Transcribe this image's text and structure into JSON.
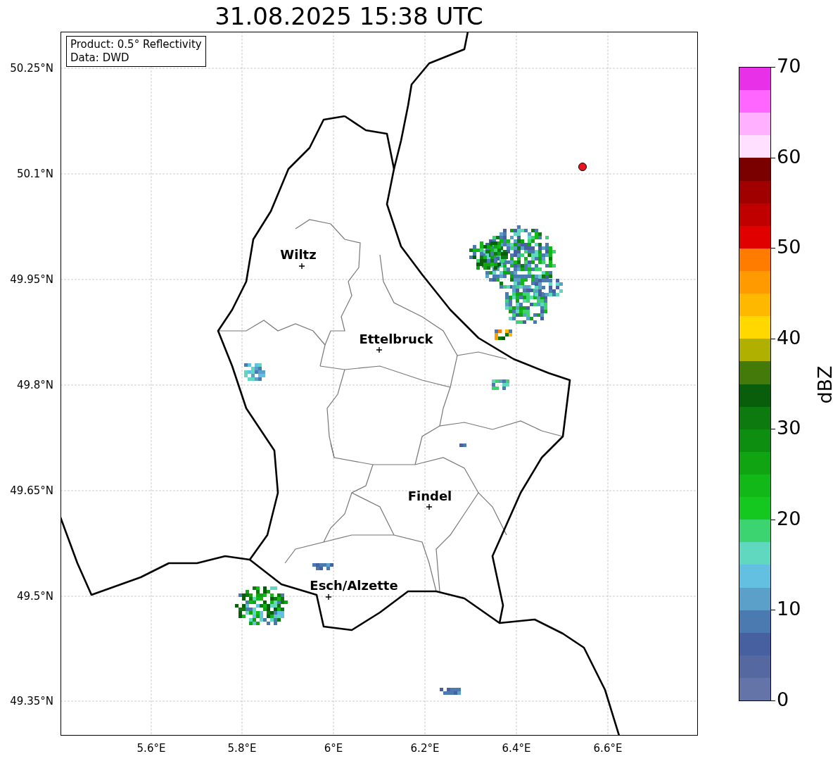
{
  "title": "31.08.2025 15:38 UTC",
  "info_lines": [
    "Product: 0.5° Reflectivity",
    "Data: DWD"
  ],
  "cities": [
    {
      "name": "Wiltz"
    },
    {
      "name": "Ettelbruck"
    },
    {
      "name": "Findel"
    },
    {
      "name": "Esch/Alzette"
    }
  ],
  "lat_ticks": [
    "50.25°N",
    "50.1°N",
    "49.95°N",
    "49.8°N",
    "49.65°N",
    "49.5°N",
    "49.35°N"
  ],
  "lon_ticks": [
    "5.6°E",
    "5.8°E",
    "6°E",
    "6.2°E",
    "6.4°E",
    "6.6°E"
  ],
  "colorbar": {
    "label": "dBZ",
    "ticks": [
      "70",
      "60",
      "50",
      "40",
      "30",
      "20",
      "10",
      "0"
    ],
    "bins": [
      {
        "color": "#e830e8"
      },
      {
        "color": "#ff66ff"
      },
      {
        "color": "#ffb0ff"
      },
      {
        "color": "#ffe0ff"
      },
      {
        "color": "#7a0000"
      },
      {
        "color": "#a00000"
      },
      {
        "color": "#c00000"
      },
      {
        "color": "#e00000"
      },
      {
        "color": "#ff7c00"
      },
      {
        "color": "#ff9a00"
      },
      {
        "color": "#ffb800"
      },
      {
        "color": "#ffd800"
      },
      {
        "color": "#b0b000"
      },
      {
        "color": "#447a0a"
      },
      {
        "color": "#085e0a"
      },
      {
        "color": "#0c7a0e"
      },
      {
        "color": "#0e8e10"
      },
      {
        "color": "#10a412"
      },
      {
        "color": "#12b818"
      },
      {
        "color": "#14c820"
      },
      {
        "color": "#3cd470"
      },
      {
        "color": "#60d8c0"
      },
      {
        "color": "#64c0e0"
      },
      {
        "color": "#5aa0c8"
      },
      {
        "color": "#4a7ab0"
      },
      {
        "color": "#4660a0"
      },
      {
        "color": "#5668a0"
      },
      {
        "color": "#6474a8"
      }
    ]
  }
}
